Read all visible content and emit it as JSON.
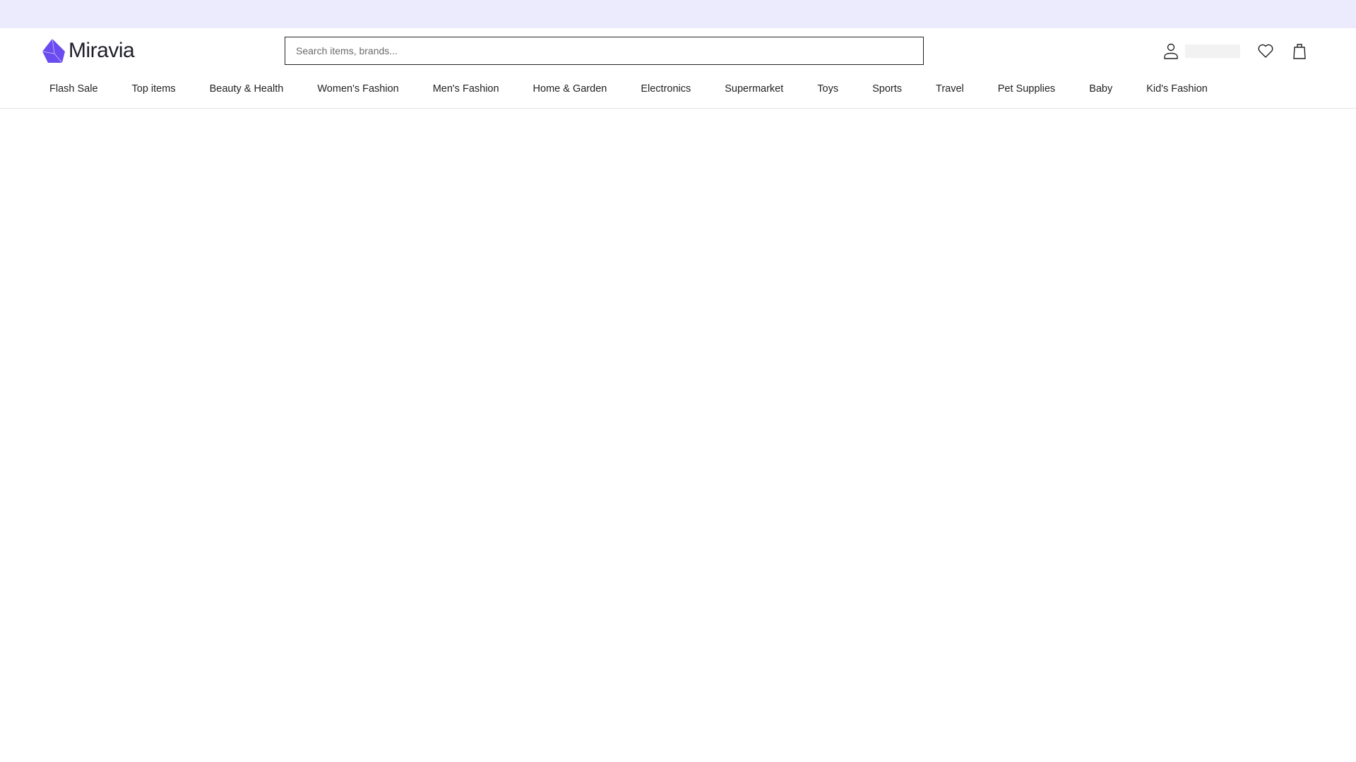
{
  "colors": {
    "banner": "#ecebfd",
    "brand": "#6a4cf0"
  },
  "header": {
    "logo_text": "Miravia",
    "search_placeholder": "Search items, brands...",
    "icons": [
      "user-icon",
      "heart-icon",
      "shopping-bag-icon"
    ]
  },
  "nav": {
    "items": [
      {
        "label": "Flash Sale"
      },
      {
        "label": "Top items"
      },
      {
        "label": "Beauty & Health"
      },
      {
        "label": "Women's Fashion"
      },
      {
        "label": "Men's Fashion"
      },
      {
        "label": "Home & Garden"
      },
      {
        "label": "Electronics"
      },
      {
        "label": "Supermarket"
      },
      {
        "label": "Toys"
      },
      {
        "label": "Sports"
      },
      {
        "label": "Travel"
      },
      {
        "label": "Pet Supplies"
      },
      {
        "label": "Baby"
      },
      {
        "label": "Kid's Fashion"
      }
    ]
  }
}
